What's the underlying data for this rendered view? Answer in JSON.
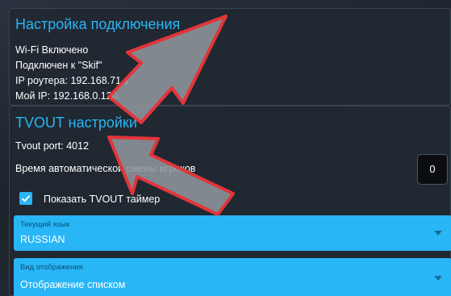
{
  "connection": {
    "title": "Настройка подключения",
    "lines": [
      "Wi-Fi Включено",
      "Подключен к \"Skif\"",
      "IP роутера: 192.168.71.1",
      "Мой IP: 192.168.0.120"
    ]
  },
  "tvout": {
    "title": "TVOUT настройки",
    "port_text": "Tvout port: 4012",
    "auto_change_label": "Время автоматической смены игроков",
    "auto_change_value": "0",
    "timer_checkbox_label": "Показать TVOUT таймер",
    "timer_checked": true,
    "language": {
      "label": "Текущий язык",
      "value": "RUSSIAN"
    },
    "display_mode": {
      "label": "Вид отображения",
      "value": "Отображение списком"
    }
  },
  "colors": {
    "accent": "#29b6f6",
    "panel": "#212832",
    "annotation_arrow_fill": "#8e959c",
    "annotation_arrow_stroke": "#e2353b"
  },
  "icons": {
    "dropdown": "caret-down-icon",
    "check": "check-icon",
    "annotation": "arrow-icon"
  }
}
